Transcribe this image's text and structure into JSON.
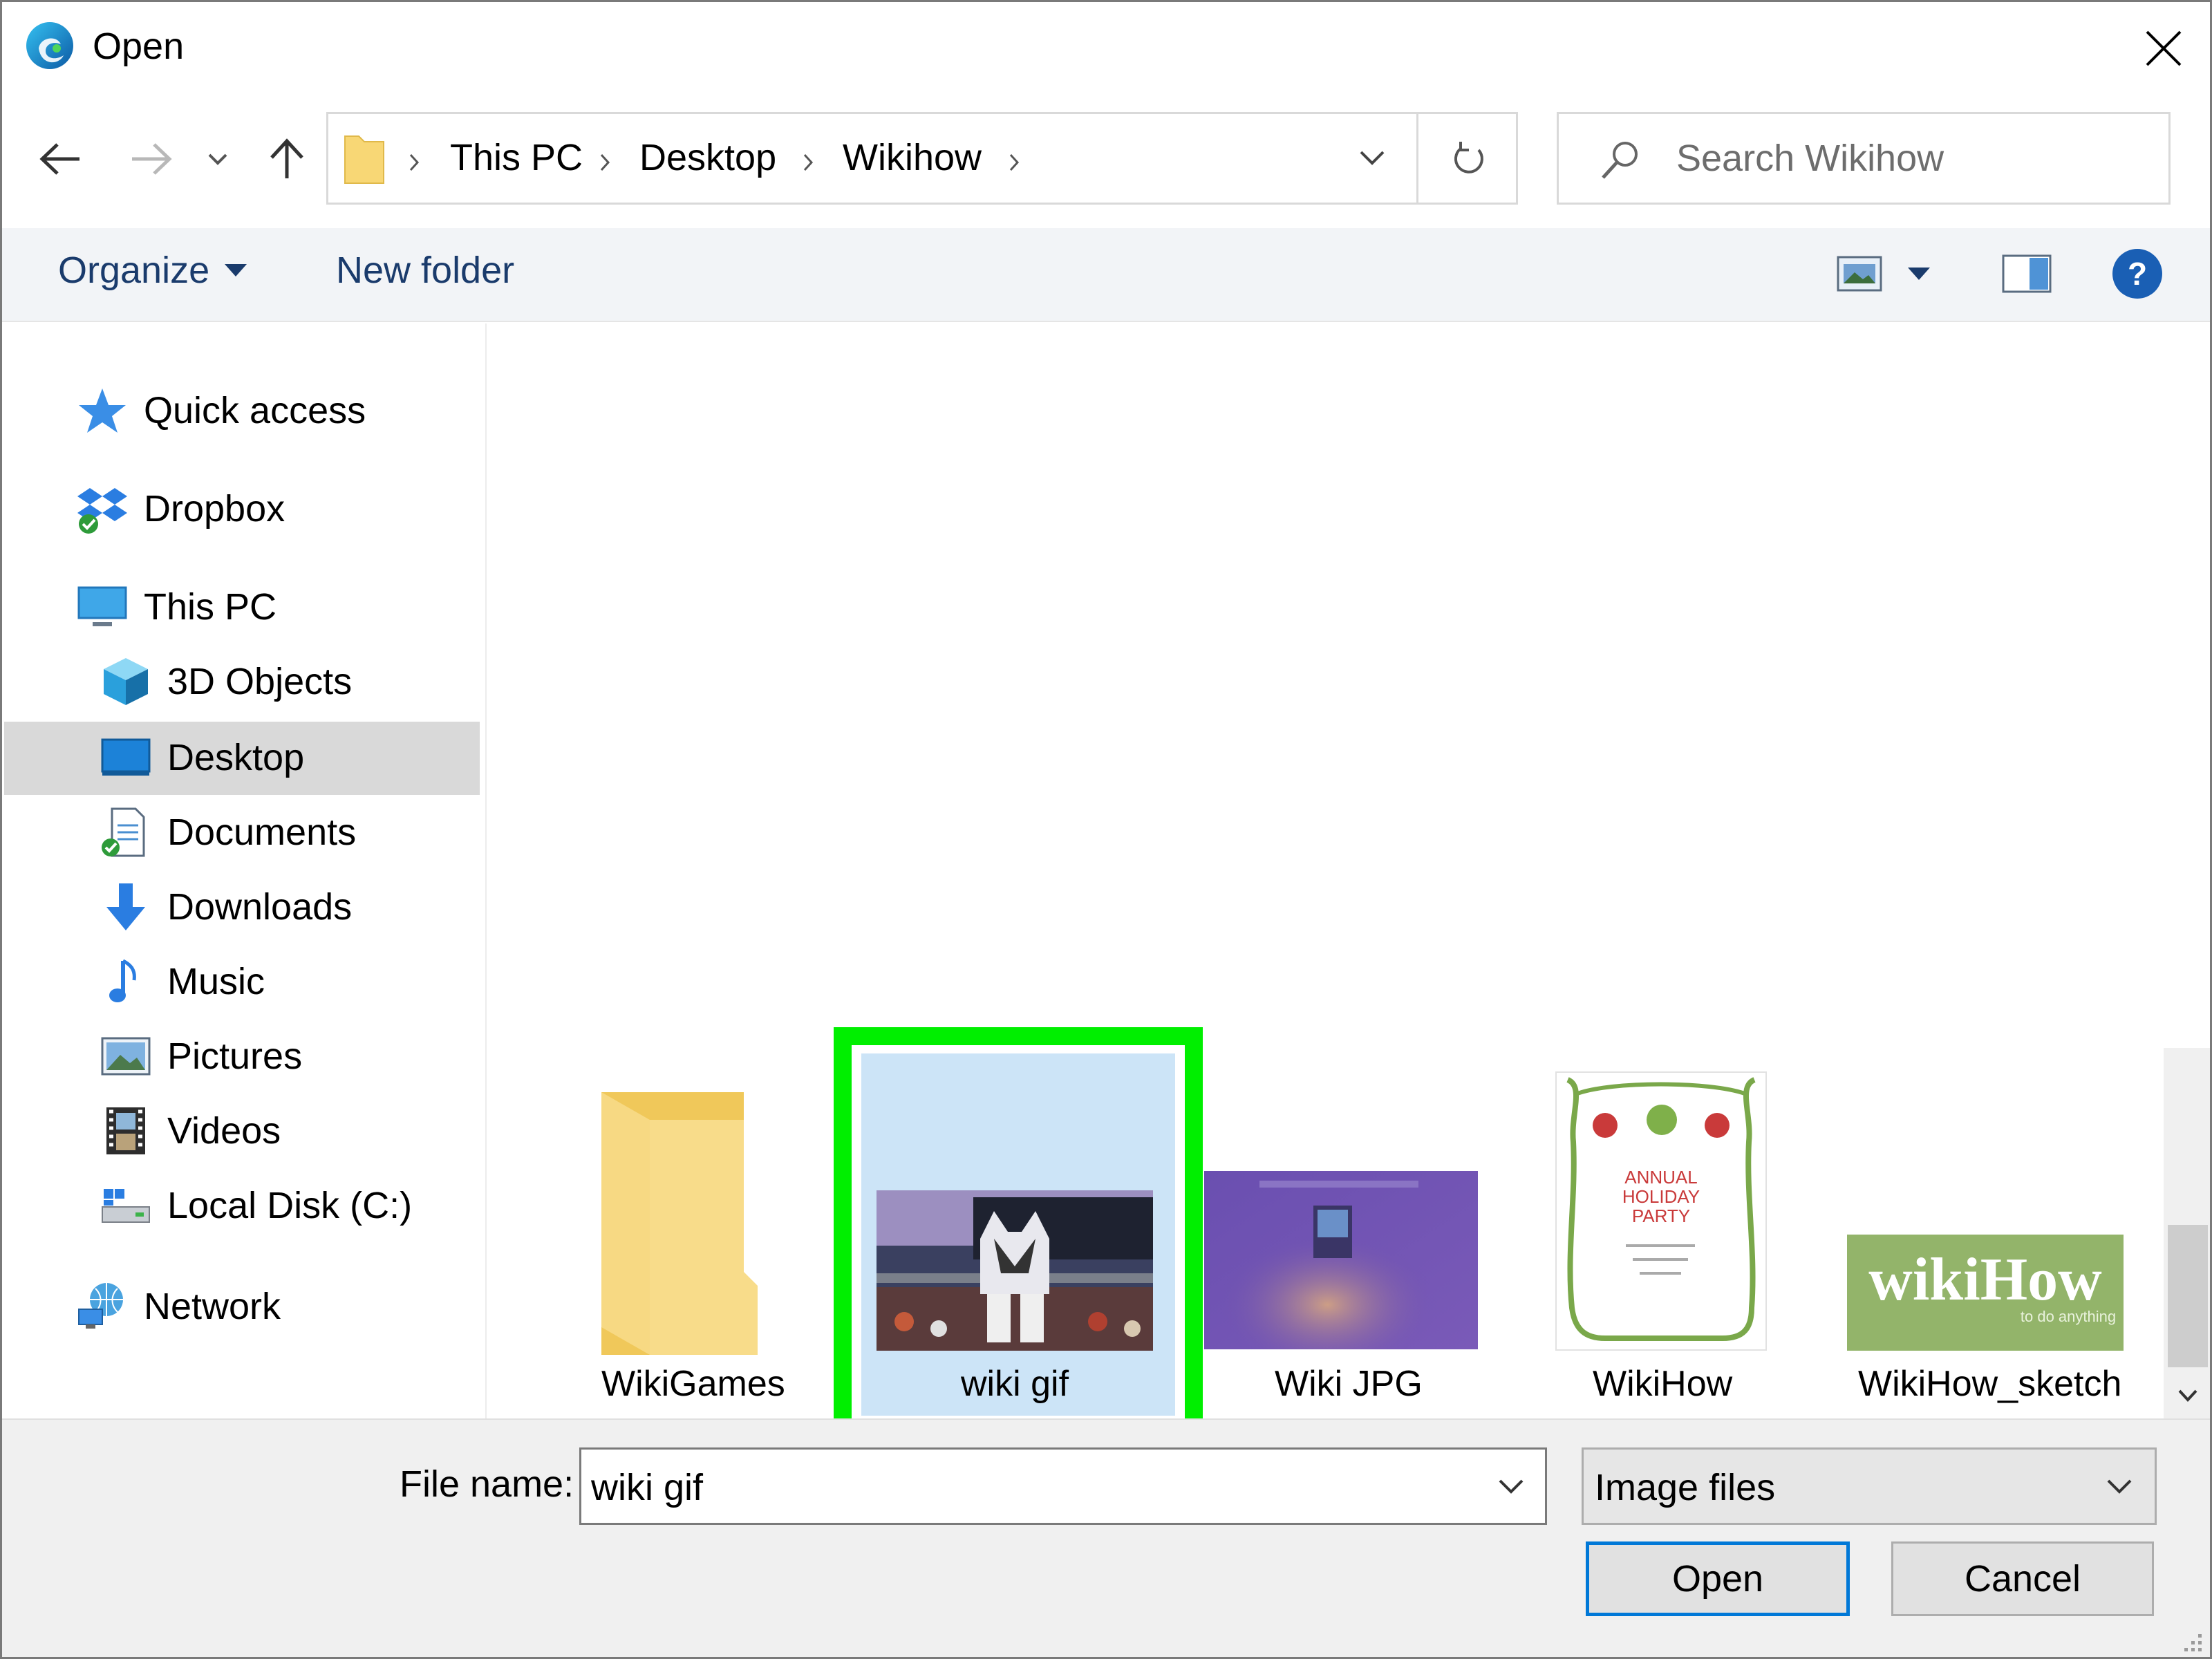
{
  "window": {
    "title": "Open",
    "app_icon": "edge-icon"
  },
  "nav": {
    "back": "back-arrow-icon",
    "forward": "forward-arrow-icon",
    "recent": "chevron-down-icon",
    "up": "up-arrow-icon"
  },
  "address": {
    "crumbs": [
      "This PC",
      "Desktop",
      "Wikihow"
    ]
  },
  "search": {
    "placeholder": "Search Wikihow"
  },
  "toolbar": {
    "organize": "Organize",
    "new_folder": "New folder"
  },
  "sidebar": {
    "items": [
      {
        "label": "Quick access",
        "icon": "star-icon"
      },
      {
        "label": "Dropbox",
        "icon": "dropbox-icon"
      },
      {
        "label": "This PC",
        "icon": "computer-icon"
      },
      {
        "label": "3D Objects",
        "icon": "cube-icon"
      },
      {
        "label": "Desktop",
        "icon": "desktop-icon"
      },
      {
        "label": "Documents",
        "icon": "documents-icon"
      },
      {
        "label": "Downloads",
        "icon": "download-arrow-icon"
      },
      {
        "label": "Music",
        "icon": "music-note-icon"
      },
      {
        "label": "Pictures",
        "icon": "pictures-icon"
      },
      {
        "label": "Videos",
        "icon": "film-icon"
      },
      {
        "label": "Local Disk (C:)",
        "icon": "drive-icon"
      },
      {
        "label": "Network",
        "icon": "network-icon"
      }
    ],
    "selected": "Desktop"
  },
  "files": [
    {
      "name": "WikiGames",
      "type": "folder"
    },
    {
      "name": "wiki gif",
      "type": "image",
      "selected": true
    },
    {
      "name": "Wiki JPG",
      "type": "image"
    },
    {
      "name": "WikiHow",
      "type": "image"
    },
    {
      "name": "WikiHow_sketch",
      "type": "image"
    }
  ],
  "thumb_text": {
    "party": [
      "ANNUAL",
      "HOLIDAY",
      "PARTY"
    ],
    "logo_main": "wikiHow",
    "logo_sub": "to do anything"
  },
  "bottom": {
    "file_name_label": "File name:",
    "file_name_value": "wiki gif",
    "file_type": "Image files",
    "open": "Open",
    "cancel": "Cancel"
  },
  "colors": {
    "accent": "#0078d7",
    "highlight": "#00ef00",
    "selection": "#cce4f7"
  }
}
